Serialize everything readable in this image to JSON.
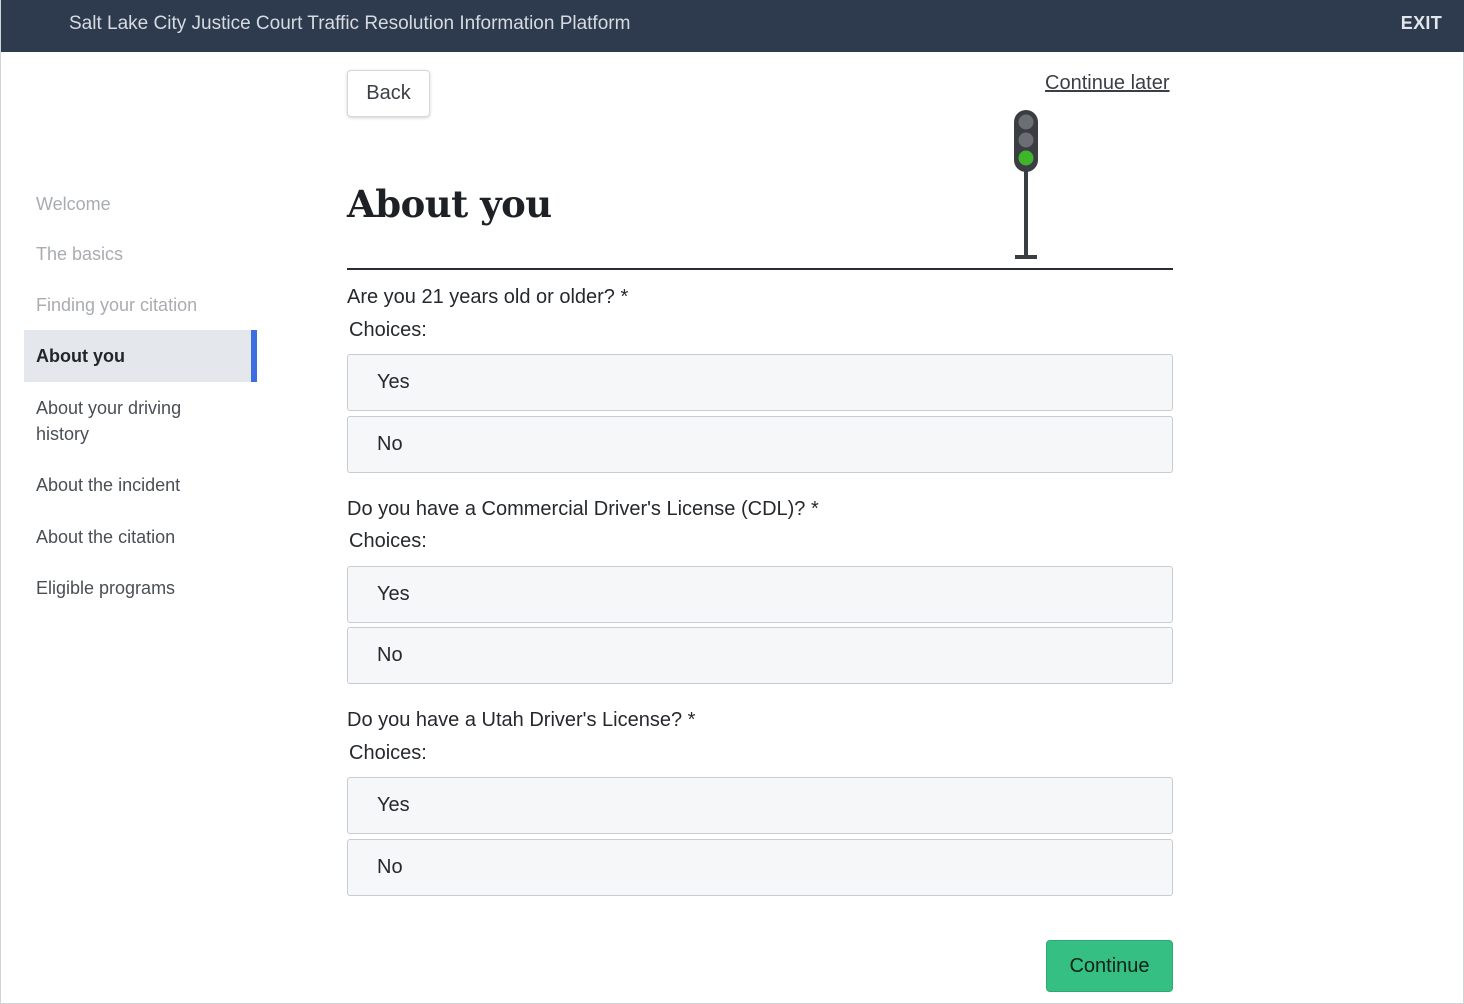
{
  "header": {
    "title": "Salt Lake City Justice Court Traffic Resolution Information Platform",
    "exit_label": "EXIT"
  },
  "sidebar": {
    "items": [
      {
        "label": "Welcome",
        "state": "done"
      },
      {
        "label": "The basics",
        "state": "done"
      },
      {
        "label": "Finding your citation",
        "state": "done"
      },
      {
        "label": "About you",
        "state": "active"
      },
      {
        "label": "About your driving history",
        "state": "todo"
      },
      {
        "label": "About the incident",
        "state": "todo"
      },
      {
        "label": "About the citation",
        "state": "todo"
      },
      {
        "label": "Eligible programs",
        "state": "todo"
      }
    ]
  },
  "toolbar": {
    "back_label": "Back",
    "continue_later_label": "Continue later"
  },
  "page": {
    "title": "About you"
  },
  "questions": [
    {
      "text": "Are you 21 years old or older? *",
      "choices_label": "Choices:",
      "options": [
        "Yes",
        "No"
      ]
    },
    {
      "text": "Do you have a Commercial Driver's License (CDL)? *",
      "choices_label": "Choices:",
      "options": [
        "Yes",
        "No"
      ]
    },
    {
      "text": "Do you have a Utah Driver's License? *",
      "choices_label": "Choices:",
      "options": [
        "Yes",
        "No"
      ]
    }
  ],
  "footer": {
    "continue_label": "Continue"
  },
  "colors": {
    "header_bg": "#2e3a4d",
    "active_nav_accent": "#3b6fe0",
    "continue_button": "#36bf82",
    "traffic_light_green": "#3fb52b"
  },
  "icons": {
    "progress": "traffic-light-icon"
  }
}
